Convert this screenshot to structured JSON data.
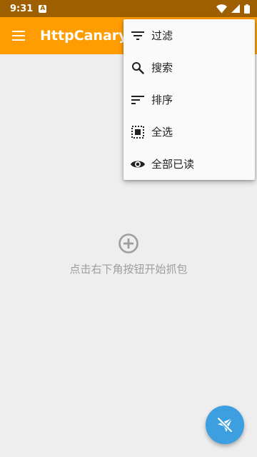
{
  "status_bar": {
    "time": "9:31",
    "notification_badge": "A"
  },
  "app_bar": {
    "title": "HttpCanary"
  },
  "menu": {
    "items": [
      {
        "label": "过滤",
        "icon": "filter-icon"
      },
      {
        "label": "搜索",
        "icon": "search-icon"
      },
      {
        "label": "排序",
        "icon": "sort-icon"
      },
      {
        "label": "全选",
        "icon": "select-all-icon"
      },
      {
        "label": "全部已读",
        "icon": "eye-icon"
      }
    ]
  },
  "empty_state": {
    "icon": "add-circle-icon",
    "message": "点击右下角按钮开始抓包"
  },
  "fab": {
    "icon": "paper-plane-off-icon"
  },
  "colors": {
    "status_bar": "#9e5f00",
    "app_bar": "#ff9d00",
    "fab": "#3d9ee0",
    "background": "#eeeeee"
  }
}
